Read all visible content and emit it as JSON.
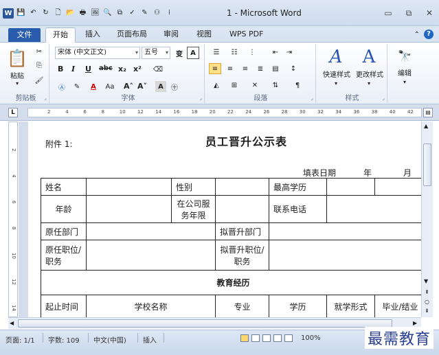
{
  "window": {
    "title": "1 - Microsoft Word",
    "word_logo": "W"
  },
  "tabs": [
    "文件",
    "开始",
    "插入",
    "页面布局",
    "审阅",
    "视图",
    "WPS PDF"
  ],
  "ribbon": {
    "clipboard": {
      "paste": "粘贴",
      "label": "剪贴板"
    },
    "font": {
      "font_name": "宋体 (中文正文)",
      "font_size": "五号",
      "bold": "B",
      "italic": "I",
      "underline": "U",
      "strike": "abc",
      "sub": "x₂",
      "sup": "x²",
      "grow": "A˄",
      "shrink": "A˅",
      "char_border": "A",
      "label": "字体"
    },
    "paragraph": {
      "label": "段落"
    },
    "styles": {
      "quick": "快速样式",
      "change": "更改样式",
      "label": "样式"
    },
    "editing": {
      "edit": "编辑"
    }
  },
  "ruler_numbers": [
    "2",
    "4",
    "6",
    "8",
    "10",
    "12",
    "14",
    "16",
    "18",
    "20",
    "22",
    "24",
    "26",
    "28",
    "30",
    "32",
    "34",
    "36",
    "38",
    "40",
    "42"
  ],
  "vruler_numbers": [
    "2",
    "4",
    "6",
    "8",
    "10",
    "12",
    "14"
  ],
  "document": {
    "appendix": "附件 1:",
    "title": "员工晋升公示表",
    "fill_date": "填表日期",
    "year": "年",
    "month": "月",
    "rows": {
      "name": "姓名",
      "gender": "性别",
      "edu": "最高学历",
      "age": "年龄",
      "service": "在公司服务年限",
      "phone": "联系电话",
      "orig_dept": "原任部门",
      "new_dept": "拟晋升部门",
      "orig_pos": "原任职位/职务",
      "new_pos": "拟晋升职位/职务",
      "education_history": "教育经历",
      "start_time": "起止时间",
      "school": "学校名称",
      "major": "专业",
      "degree": "学历",
      "study_form": "就学形式",
      "grad": "毕业/结业"
    }
  },
  "status": {
    "page": "页面: 1/1",
    "words": "字数: 109",
    "lang": "中文(中国)",
    "mode": "插入",
    "zoom": "100%"
  },
  "brand": "最需教育"
}
